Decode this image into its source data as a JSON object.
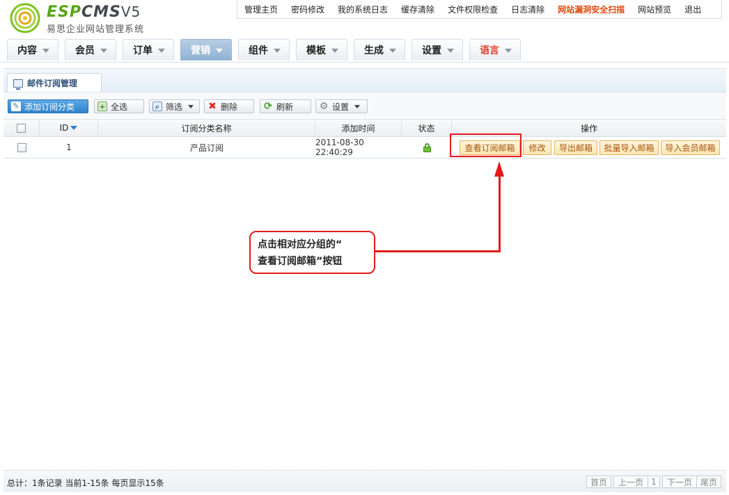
{
  "logo": {
    "brand_a": "ESP",
    "brand_b": "CMS",
    "version": "V5",
    "subtitle": "易思企业网站管理系统"
  },
  "toplinks": [
    {
      "label": "管理主页"
    },
    {
      "label": "密码修改"
    },
    {
      "label": "我的系统日志"
    },
    {
      "label": "缓存清除"
    },
    {
      "label": "文件权限检查"
    },
    {
      "label": "日志清除"
    },
    {
      "label": "网站漏洞安全扫描"
    },
    {
      "label": "网站预览"
    },
    {
      "label": "退出"
    }
  ],
  "nav": [
    {
      "label": "内容"
    },
    {
      "label": "会员"
    },
    {
      "label": "订单"
    },
    {
      "label": "营销"
    },
    {
      "label": "组件"
    },
    {
      "label": "模板"
    },
    {
      "label": "生成"
    },
    {
      "label": "设置"
    },
    {
      "label": "语言"
    }
  ],
  "panel": {
    "tab_title": "邮件订阅管理"
  },
  "toolbar": {
    "add": "添加订阅分类",
    "select_all": "全选",
    "filter": "筛选",
    "delete": "删除",
    "refresh": "刷新",
    "settings": "设置"
  },
  "table": {
    "headers": {
      "id": "ID",
      "name": "订阅分类名称",
      "time": "添加时间",
      "status": "状态",
      "ops": "操作"
    },
    "rows": [
      {
        "id": "1",
        "name": "产品订阅",
        "time": "2011-08-30 22:40:29",
        "ops": [
          "查看订阅邮箱",
          "修改",
          "导出邮箱",
          "批量导入邮箱",
          "导入会员邮箱"
        ]
      }
    ]
  },
  "annotation": {
    "line1": "点击相对应分组的“",
    "line2": "查看订阅邮箱”按钮"
  },
  "footer": {
    "summary": "总计：1条记录 当前1-15条 每页显示15条",
    "first": "首页",
    "prev": "上一页",
    "page": "1",
    "next": "下一页",
    "last": "尾页"
  },
  "colors": {
    "accent": "#2f82cd",
    "danger": "#e31b1b",
    "op_text": "#a8540d"
  }
}
